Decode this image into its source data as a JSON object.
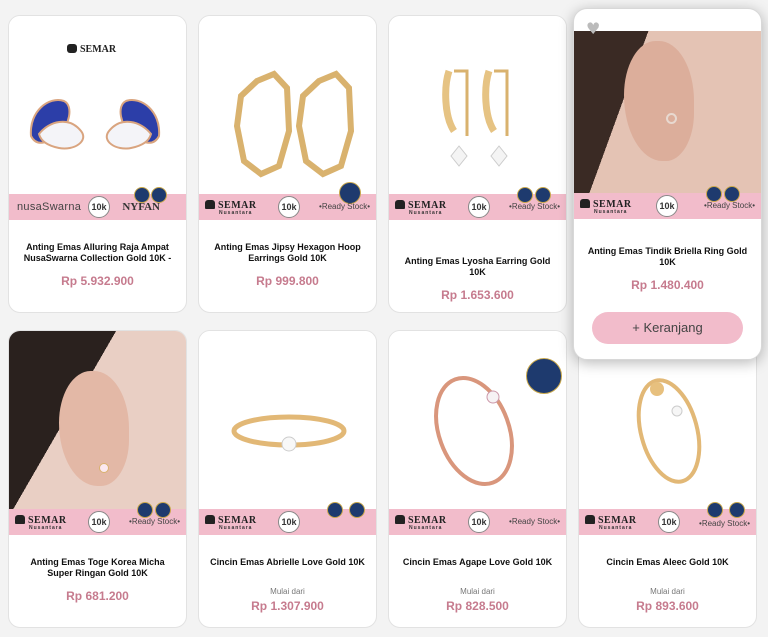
{
  "brand": {
    "logo_text": "SEMAR",
    "logo_sub": "Nusantara"
  },
  "band": {
    "karat": "10k",
    "ready_stock": "•Ready Stock•",
    "nusa": "nusaSwarna",
    "nyfan": "NYFAN"
  },
  "products": [
    {
      "title": "Anting Emas Alluring Raja Ampat NusaSwarna Collection Gold 10K -",
      "price": "Rp 5.932.900"
    },
    {
      "title": "Anting Emas Jipsy Hexagon Hoop Earrings Gold 10K",
      "price": "Rp 999.800"
    },
    {
      "title": "Anting Emas Lyosha Earring Gold 10K",
      "price": "Rp 1.653.600"
    },
    {
      "title": "Anting Emas Tindik Briella Ring Gold 10K",
      "price": "Rp 1.480.400",
      "cart_label": "+ Keranjang"
    },
    {
      "title": "Anting Emas Toge Korea Micha Super Ringan Gold 10K",
      "price": "Rp 681.200"
    },
    {
      "title": "Cincin Emas Abrielle Love Gold 10K",
      "from": "Mulai dari",
      "price": "Rp 1.307.900"
    },
    {
      "title": "Cincin Emas Agape Love Gold 10K",
      "from": "Mulai dari",
      "price": "Rp 828.500"
    },
    {
      "title": "Cincin Emas Aleec Gold 10K",
      "from": "Mulai dari",
      "price": "Rp 893.600"
    }
  ]
}
